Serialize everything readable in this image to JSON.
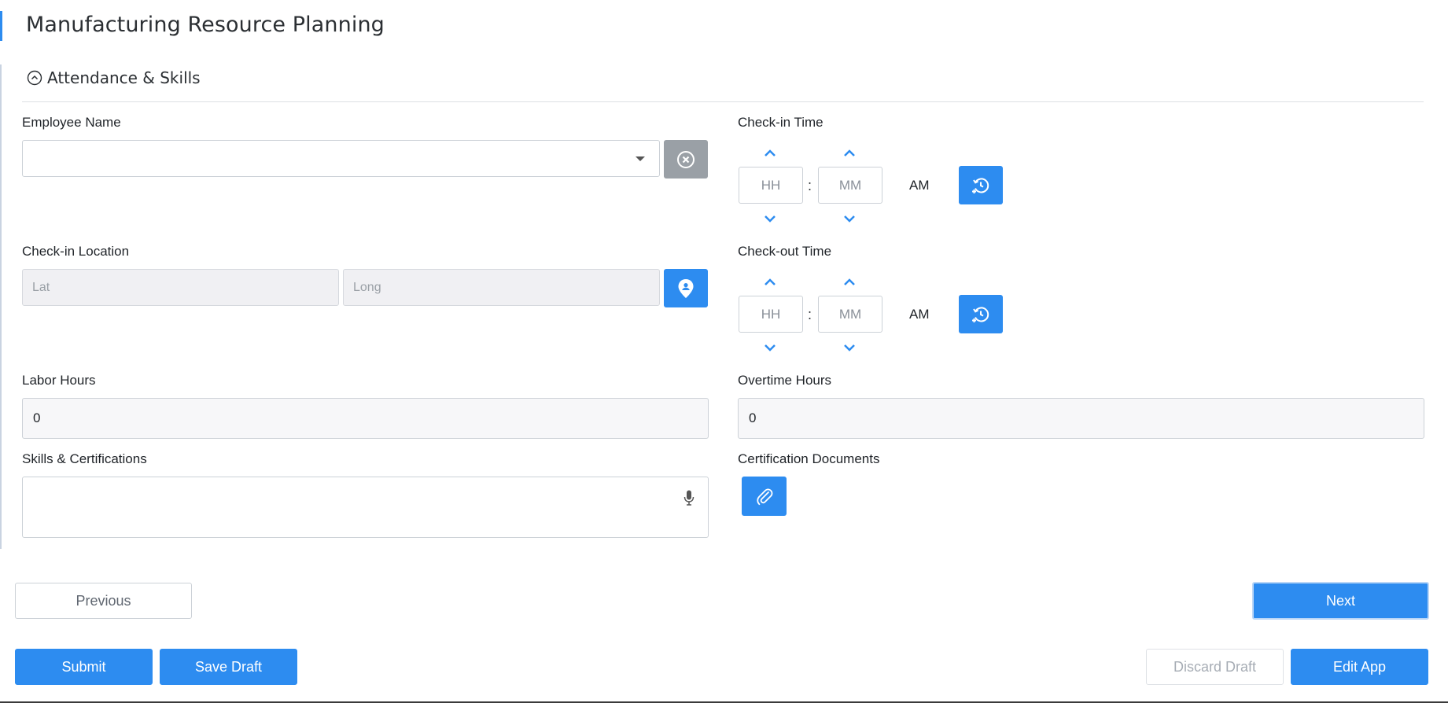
{
  "app": {
    "title": "Manufacturing Resource Planning"
  },
  "section": {
    "title": "Attendance & Skills",
    "collapse_icon": "chevron-up-circle-icon"
  },
  "fields": {
    "employee_name": {
      "label": "Employee Name",
      "value": "",
      "clear_icon": "close-circle-icon"
    },
    "checkin_location": {
      "label": "Check-in Location",
      "lat_placeholder": "Lat",
      "long_placeholder": "Long",
      "locate_icon": "map-pin-icon"
    },
    "labor_hours": {
      "label": "Labor Hours",
      "value": "0"
    },
    "skills": {
      "label": "Skills & Certifications",
      "value": "",
      "mic_icon": "microphone-icon"
    },
    "checkin_time": {
      "label": "Check-in Time",
      "hour_placeholder": "HH",
      "minute_placeholder": "MM",
      "separator": ":",
      "meridiem": "AM",
      "now_icon": "clock-history-icon"
    },
    "checkout_time": {
      "label": "Check-out Time",
      "hour_placeholder": "HH",
      "minute_placeholder": "MM",
      "separator": ":",
      "meridiem": "AM",
      "now_icon": "clock-history-icon"
    },
    "overtime_hours": {
      "label": "Overtime Hours",
      "value": "0"
    },
    "cert_docs": {
      "label": "Certification Documents",
      "attach_icon": "paperclip-icon"
    }
  },
  "nav": {
    "previous_label": "Previous",
    "next_label": "Next"
  },
  "actions": {
    "submit_label": "Submit",
    "save_draft_label": "Save Draft",
    "discard_draft_label": "Discard Draft",
    "edit_app_label": "Edit App"
  },
  "colors": {
    "primary": "#2d8cf0",
    "disabled_gray": "#9aa0a6"
  }
}
